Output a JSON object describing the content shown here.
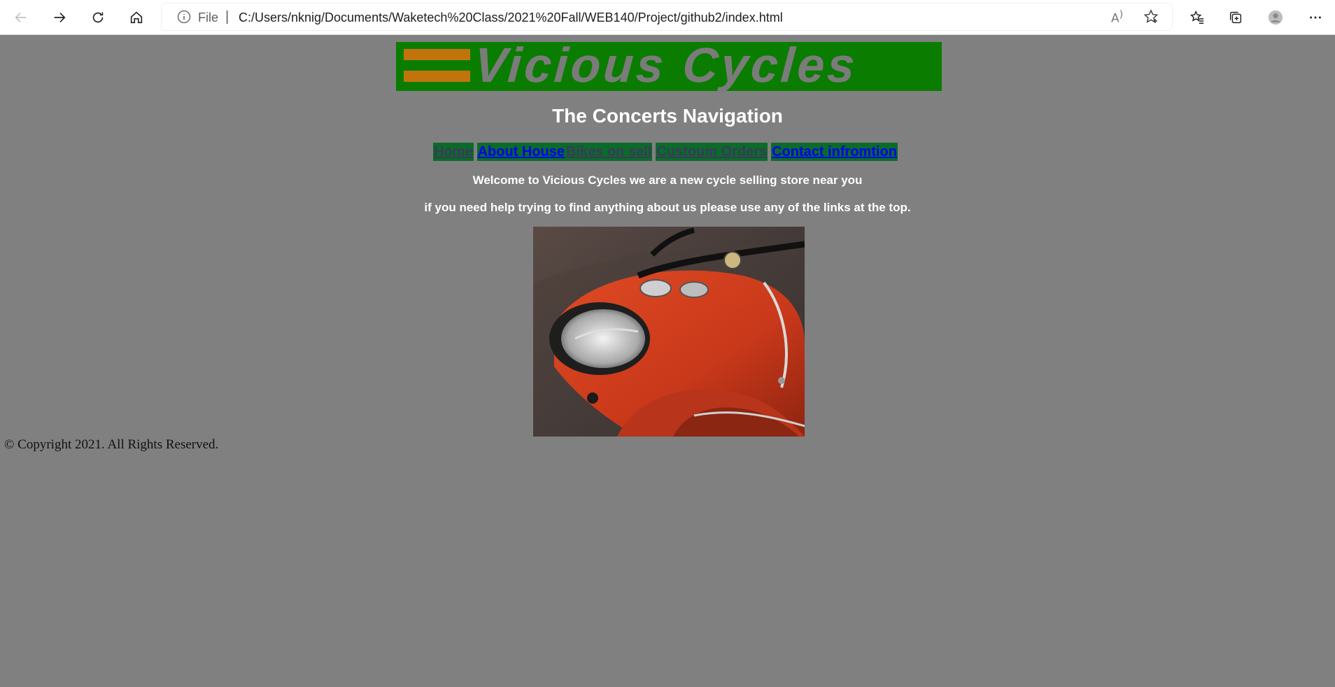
{
  "browser": {
    "scheme_label": "File",
    "url": "C:/Users/nknig/Documents/Waketech%20Class/2021%20Fall/WEB140/Project/github2/index.html",
    "read_aloud_label": "A",
    "icons": [
      "back-icon",
      "forward-icon",
      "refresh-icon",
      "home-icon",
      "info-icon",
      "read-aloud-icon",
      "add-favorite-icon",
      "favorites-icon",
      "collections-icon",
      "profile-icon",
      "more-icon"
    ]
  },
  "header": {
    "logo_text": "Vicious Cycles",
    "nav_title": "The Concerts Navigation"
  },
  "nav": {
    "items": [
      {
        "label": "Home",
        "style": "dim"
      },
      {
        "label": "About House ",
        "style": "blue"
      },
      {
        "label": "Bikes on sell",
        "style": "dim"
      },
      {
        "label": "Custoum Orders",
        "style": "dim"
      },
      {
        "label": "Contact infromtion",
        "style": "blue"
      }
    ]
  },
  "content": {
    "welcome": "Welcome to Vicious Cycles we are a new cycle selling store near you",
    "help": "if you need help trying to find anything about us please use any of the links at the top."
  },
  "footer": {
    "copyright": "© Copyright 2021. All Rights Reserved."
  },
  "colors": {
    "page_bg": "#808080",
    "logo_bg": "#0a7d00",
    "logo_stripe": "#c2740c",
    "nav_bg": "#0a6b2a",
    "link_blue": "#0000ee"
  }
}
